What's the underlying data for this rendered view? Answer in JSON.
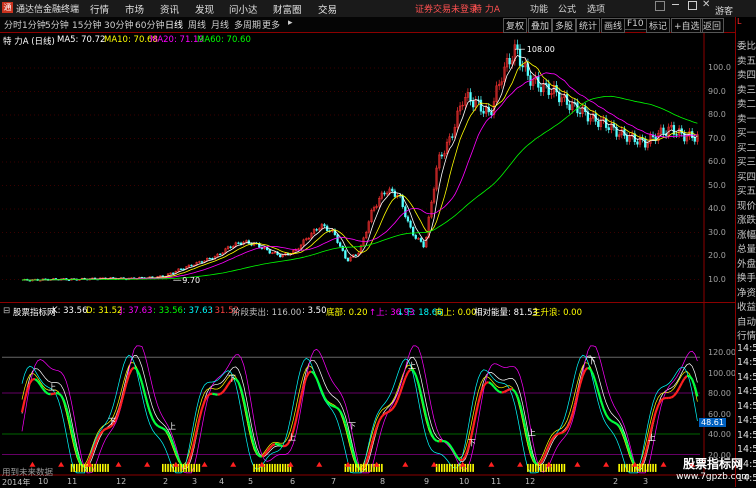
{
  "app": {
    "title": "通达信金融终端",
    "logo": "通"
  },
  "menu": [
    "行情",
    "市场",
    "资讯",
    "发现",
    "问小达",
    "财富圈",
    "交易"
  ],
  "status": {
    "warning": "证券交易未登录",
    "stock": "特 力A"
  },
  "right_menu": [
    "功能",
    "公式",
    "选项"
  ],
  "guest": "游客",
  "toolbar": {
    "periods": [
      "分时",
      "1分钟",
      "5分钟",
      "15分钟",
      "30分钟",
      "60分钟",
      "日线",
      "周线",
      "月线",
      "多周期",
      "更多"
    ],
    "selected": "日线",
    "buttons": [
      "复权",
      "叠加",
      "多股",
      "统计",
      "画线",
      "F10",
      "标记",
      "+自选",
      "返回"
    ]
  },
  "ma_legend": {
    "title": "特 力A (日线)",
    "items": [
      {
        "label": "MA5: 70.72",
        "color": "#ffffff"
      },
      {
        "label": "MA10: 70.68",
        "color": "#ffff00"
      },
      {
        "label": "MA20: 71.19",
        "color": "#ff00ff"
      },
      {
        "label": "MA60: 70.60",
        "color": "#00ff00"
      }
    ]
  },
  "price_axis": [
    "100.0",
    "90.0",
    "80.0",
    "70.0",
    "60.0",
    "50.0",
    "40.0",
    "30.0",
    "20.0",
    "10.0"
  ],
  "price_annotations": {
    "high": "108.00",
    "low": "9.70"
  },
  "indicator_legend": {
    "name": "股票指标网",
    "items": [
      {
        "label": "K: 33.56",
        "color": "#ffffff"
      },
      {
        "label": "D: 31.52",
        "color": "#ffff00"
      },
      {
        "label": "J: 37.63",
        "color": "#ff00ff"
      },
      {
        "label": ": 33.56",
        "color": "#00ff00"
      },
      {
        "label": ": 37.63",
        "color": "#00ffff"
      },
      {
        "label": ": 31.52",
        "color": "#ff4040"
      },
      {
        "label": "阶段卖出: 116.00",
        "color": "#c0c0c0"
      },
      {
        "label": ": 3.50",
        "color": "#ffffff"
      },
      {
        "label": "底部: 0.20",
        "color": "#ffff00"
      },
      {
        "label": "↑上: 36.93",
        "color": "#ff00ff"
      },
      {
        "label": "↓下: 18.66",
        "color": "#00ffff"
      },
      {
        "label": "向上: 0.00",
        "color": "#ffff00"
      },
      {
        "label": "相对能量: 81.53",
        "color": "#ffffff"
      },
      {
        "label": "主升浪: 0.00",
        "color": "#ffff00"
      }
    ]
  },
  "indicator_axis": [
    "120.00",
    "100.00",
    "80.00",
    "60.00",
    "40.00",
    "20.00"
  ],
  "indicator_current": "48.61",
  "footer_note": "用到未来数据",
  "dates": [
    "2014年",
    "10",
    "11",
    "12",
    "2",
    "3",
    "4",
    "5",
    "6",
    "7",
    "8",
    "9",
    "10",
    "11",
    "12",
    "2",
    "3"
  ],
  "side_panel": [
    "委比",
    "卖五",
    "卖四",
    "卖三",
    "卖二",
    "卖一",
    "买一",
    "买二",
    "买三",
    "买四",
    "买五",
    "现价",
    "涨跌",
    "涨幅",
    "总量",
    "外盘",
    "换手",
    "净资",
    "收益",
    "自动",
    "行情",
    "14:5",
    "14:5",
    "14:5",
    "14:5",
    "14:5",
    "14:5",
    "14:5",
    "14:5",
    "14:5",
    "14:5"
  ],
  "watermark": {
    "line1": "股票指标网",
    "line2": "www.7gpzb.com"
  },
  "chart_data": [
    {
      "type": "candlestick",
      "title": "特 力A (日线)",
      "ylim": [
        0,
        110
      ],
      "yticks": [
        10,
        20,
        30,
        40,
        50,
        60,
        70,
        80,
        90,
        100
      ],
      "series": [
        {
          "name": "MA5",
          "value": 70.72
        },
        {
          "name": "MA10",
          "value": 70.68
        },
        {
          "name": "MA20",
          "value": 71.19
        },
        {
          "name": "MA60",
          "value": 70.6
        }
      ],
      "close_path": [
        9.7,
        9.8,
        10.0,
        10.1,
        10.0,
        10.2,
        10.4,
        10.5,
        10.3,
        10.6,
        10.8,
        11.5,
        14,
        16,
        18,
        20,
        24,
        26,
        25,
        22,
        20,
        22,
        28,
        33,
        30,
        18,
        22,
        40,
        48,
        46,
        30,
        24,
        60,
        70,
        88,
        85,
        80,
        98,
        108,
        96,
        92,
        90,
        85,
        82,
        78,
        76,
        72,
        70,
        68,
        72,
        74,
        71,
        70.7
      ],
      "annotations": [
        {
          "label": "108.00",
          "value": 108.0
        },
        {
          "label": "9.70",
          "value": 9.7
        }
      ]
    },
    {
      "type": "line",
      "title": "股票指标网",
      "ylim": [
        0,
        130
      ],
      "yticks": [
        20,
        40,
        60,
        80,
        100,
        120
      ],
      "current": 48.61
    }
  ]
}
